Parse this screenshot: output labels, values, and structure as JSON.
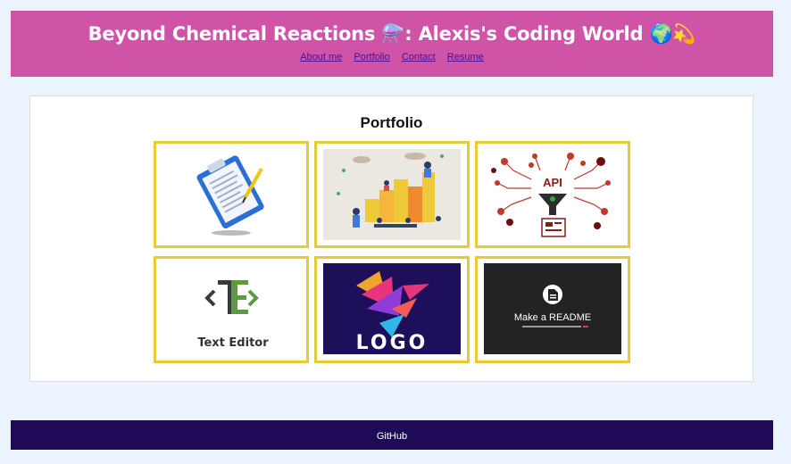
{
  "header": {
    "title": "Beyond Chemical Reactions ⚗️: Alexis's Coding World 🌍💫",
    "nav": [
      {
        "label": "About me"
      },
      {
        "label": "Portfolio"
      },
      {
        "label": "Contact"
      },
      {
        "label": "Resume"
      }
    ]
  },
  "portfolio": {
    "heading": "Portfolio",
    "tiles": [
      {
        "icon": "clipboard-quiz-icon"
      },
      {
        "icon": "team-workflow-illustration"
      },
      {
        "icon": "api-funnel-icon",
        "label": "API"
      },
      {
        "icon": "text-editor-logo",
        "label": "Text Editor"
      },
      {
        "icon": "logo-bird-icon",
        "label": "LOGO"
      },
      {
        "icon": "readme-generator-icon",
        "label": "Make a README"
      }
    ]
  },
  "footer": {
    "link": "GitHub"
  },
  "colors": {
    "header_bg": "#cf53a6",
    "footer_bg": "#1e0a56",
    "page_bg": "#ebf4fd",
    "tile_border": "#e5cc36",
    "nav_link": "#4a0f99"
  }
}
